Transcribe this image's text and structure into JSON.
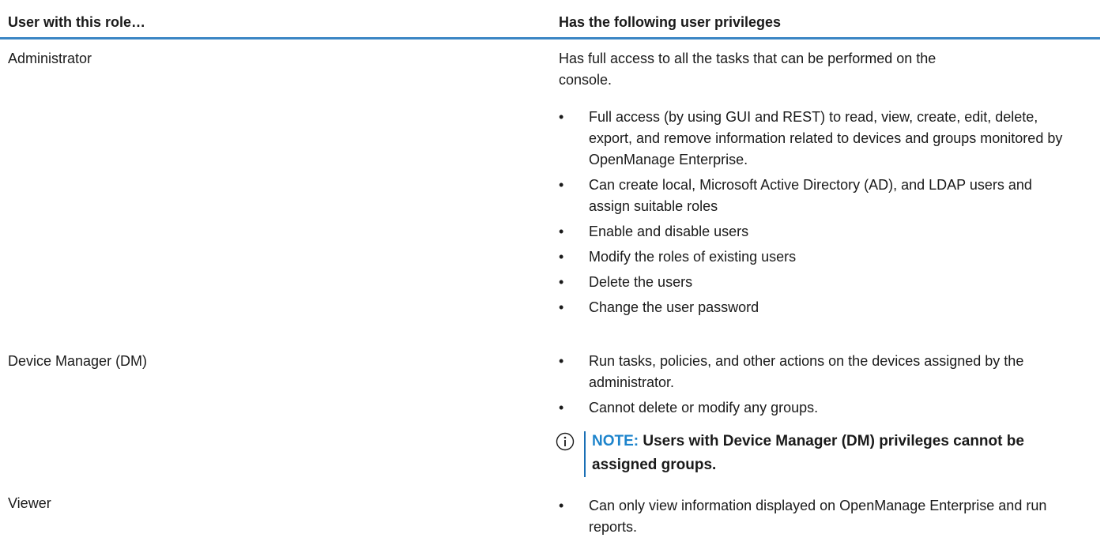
{
  "header": {
    "col1": "User with this role…",
    "col2": "Has the following user privileges"
  },
  "rows": [
    {
      "role": "Administrator",
      "intro": "Has full access to all the tasks that can be performed on the console.",
      "bullets": [
        "Full access (by using GUI and REST) to read, view, create, edit, delete, export, and remove information related to devices and groups monitored by OpenManage Enterprise.",
        "Can create local, Microsoft Active Directory (AD), and LDAP users and assign suitable roles",
        "Enable and disable users",
        "Modify the roles of existing users",
        "Delete the users",
        "Change the user password"
      ]
    },
    {
      "role": "Device Manager (DM)",
      "bullets": [
        "Run tasks, policies, and other actions on the devices assigned by the administrator.",
        "Cannot delete or modify any groups."
      ],
      "note": {
        "label": "NOTE:",
        "text": "Users with Device Manager (DM) privileges cannot be assigned groups."
      }
    },
    {
      "role": "Viewer",
      "bullets": [
        "Can only view information displayed on OpenManage Enterprise and run reports."
      ]
    }
  ],
  "bullet_glyph": "•",
  "icons": {
    "note": "info-circle-icon"
  },
  "colors": {
    "header_rule": "#3b86c4",
    "note_label": "#1d84cc",
    "note_bar": "#1a6fb5"
  }
}
